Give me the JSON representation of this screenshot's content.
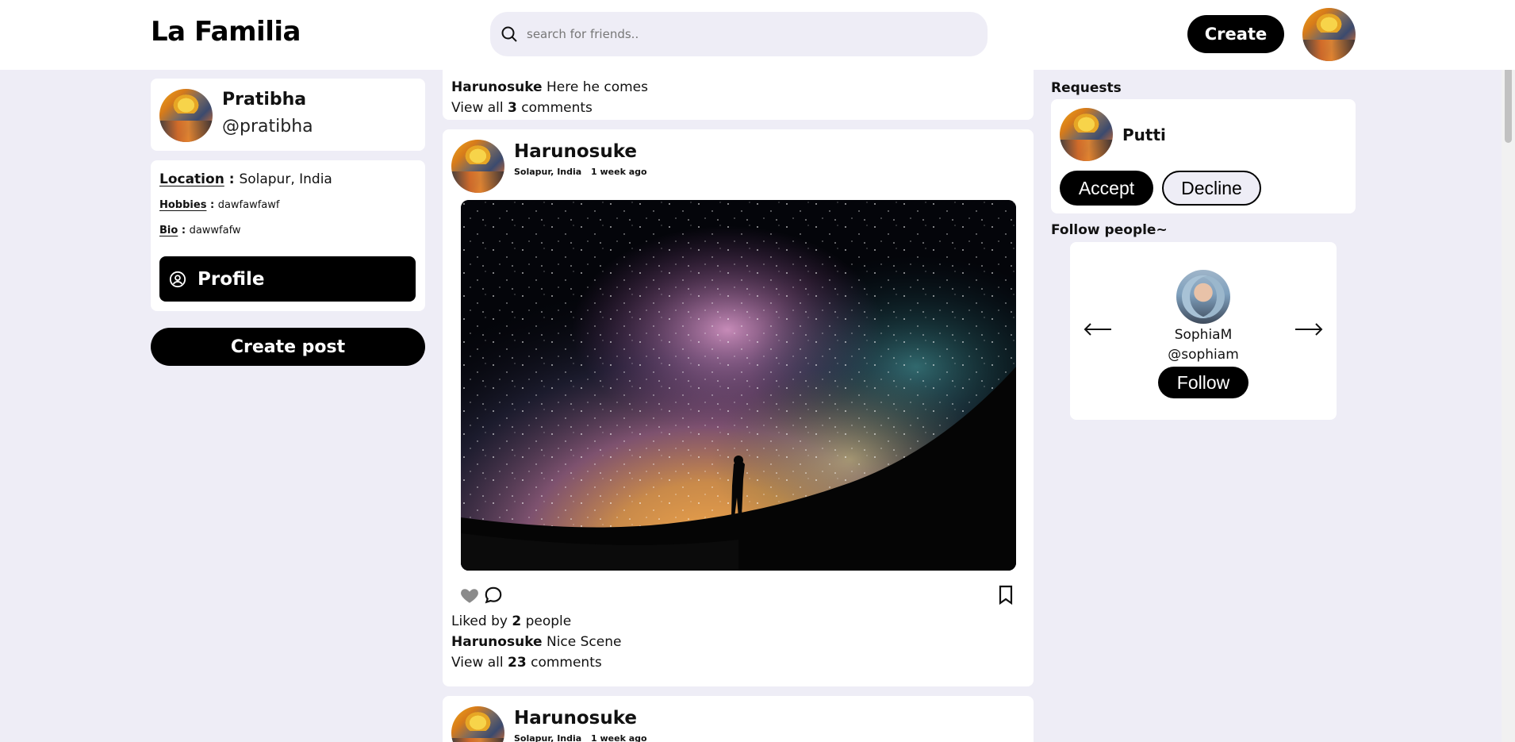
{
  "app": {
    "title": "La Familia"
  },
  "header": {
    "search_placeholder": "search for friends..",
    "search_icon": "search-icon",
    "create_label": "Create",
    "avatar_icon": "user-avatar"
  },
  "profile": {
    "name": "Pratibha",
    "handle": "@pratibha",
    "location_label": "Location",
    "location": "Solapur, India",
    "hobbies_label": "Hobbies",
    "hobbies": "dawfawfawf",
    "bio_label": "Bio",
    "bio": "dawwfafw",
    "profile_button": "Profile",
    "profile_icon": "user-circle-icon",
    "create_post_button": "Create post"
  },
  "feed": {
    "previous_post": {
      "author": "Harunosuke",
      "caption": "Here he comes",
      "comments_prefix": "View all",
      "comments_count": "3",
      "comments_suffix": "comments"
    },
    "posts": [
      {
        "author": "Harunosuke",
        "location": "Solapur, India",
        "time": "1 week ago",
        "liked_prefix": "Liked by",
        "likes": "2",
        "liked_suffix": "people",
        "caption_author": "Harunosuke",
        "caption": "Nice Scene",
        "comments_prefix": "View all",
        "comments_count": "23",
        "comments_suffix": "comments",
        "image_icon": "starry-sky-image"
      },
      {
        "author": "Harunosuke",
        "location": "Solapur, India",
        "time": "1 week ago"
      }
    ]
  },
  "requests": {
    "title": "Requests",
    "items": [
      {
        "name": "Putti",
        "accept": "Accept",
        "decline": "Decline"
      }
    ]
  },
  "follow": {
    "title": "Follow people~",
    "suggestion": {
      "name": "SophiaM",
      "handle": "@sophiam",
      "button": "Follow"
    },
    "prev_icon": "arrow-left-icon",
    "next_icon": "arrow-right-icon"
  },
  "colors": {
    "background": "#eeedf6",
    "card": "#ffffff",
    "primary": "#000000"
  }
}
